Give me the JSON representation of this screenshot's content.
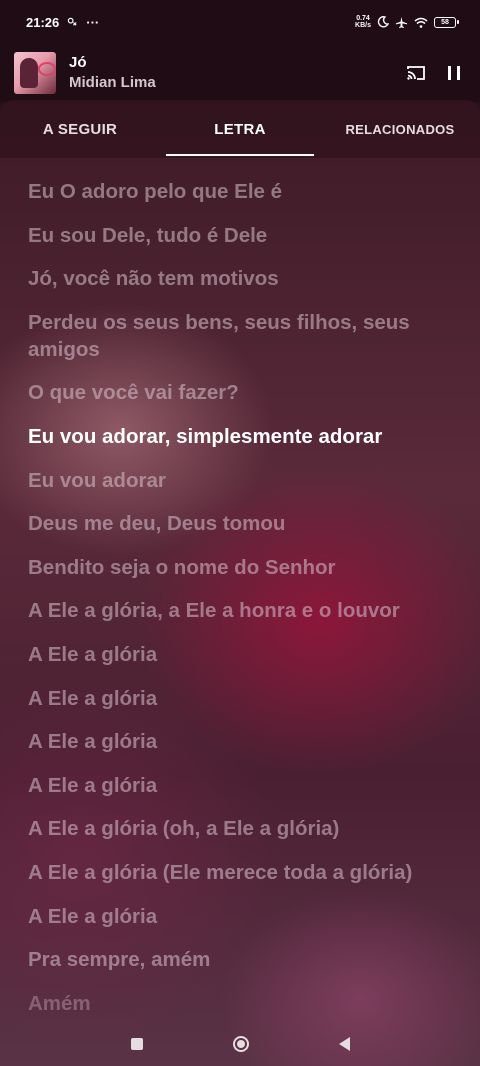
{
  "status_bar": {
    "time": "21:26",
    "net_speed_value": "0.74",
    "net_speed_unit": "KB/s",
    "battery": "58"
  },
  "mini_player": {
    "title": "Jó",
    "artist": "Midian Lima"
  },
  "tabs": [
    {
      "label": "A SEGUIR",
      "active": false
    },
    {
      "label": "LETRA",
      "active": true
    },
    {
      "label": "RELACIONADOS",
      "active": false
    }
  ],
  "lyrics": [
    "Eu O adoro pelo que Ele é",
    "Eu sou Dele, tudo é Dele",
    "Jó, você não tem motivos",
    "Perdeu os seus bens, seus filhos, seus amigos",
    "O que você vai fazer?",
    "Eu vou adorar, simplesmente adorar",
    "Eu vou adorar",
    "Deus me deu, Deus tomou",
    "Bendito seja o nome do Senhor",
    "A Ele a glória, a Ele a honra e o louvor",
    "A Ele a glória",
    "A Ele a glória",
    "A Ele a glória",
    "A Ele a glória",
    "A Ele a glória (oh, a Ele a glória)",
    "A Ele a glória (Ele merece toda a glória)",
    "A Ele a glória",
    "Pra sempre, amém",
    "Amém"
  ],
  "active_lyric_index": 5
}
